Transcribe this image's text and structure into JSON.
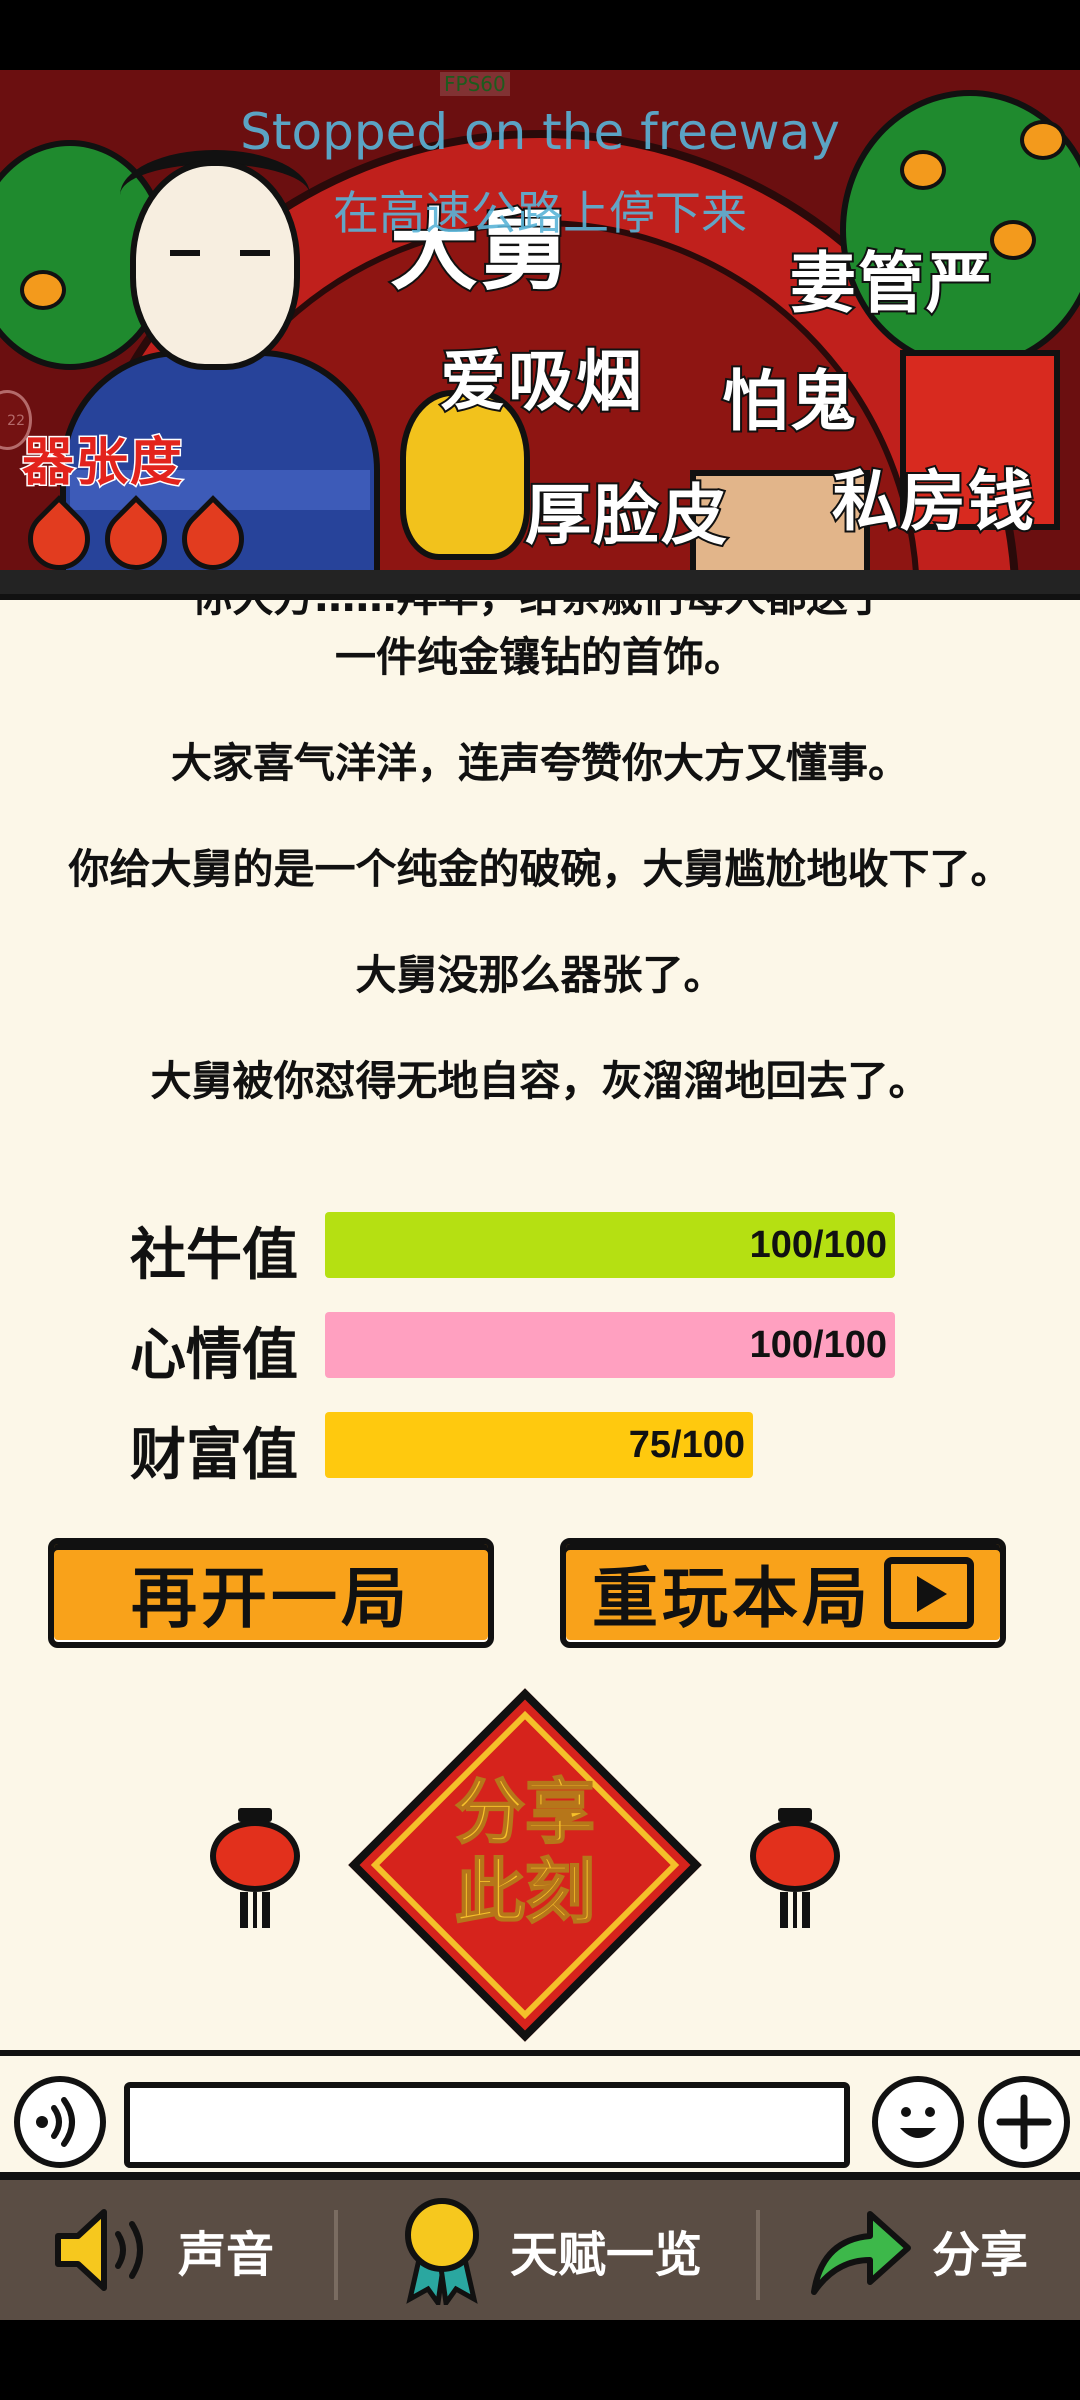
{
  "hud": {
    "fps": "FPS60",
    "caption_en": "Stopped on the freeway",
    "caption_zh": "在高速公路上停下来",
    "side_badge": "22"
  },
  "banner": {
    "title": "大舅",
    "tags": [
      "妻管严",
      "爱吸烟",
      "怕鬼",
      "厚脸皮",
      "私房钱"
    ],
    "attribute_label": "器张度",
    "flames": 3
  },
  "story": {
    "cut_line": "你大方……拜年，给亲戚们每人都送了",
    "lines": [
      "一件纯金镶钻的首饰。",
      "大家喜气洋洋，连声夸赞你大方又懂事。",
      "你给大舅的是一个纯金的破碗，大舅尴尬地收下了。",
      "大舅没那么器张了。",
      "大舅被你怼得无地自容，灰溜溜地回去了。"
    ]
  },
  "stats": [
    {
      "label": "社牛值",
      "value": 100,
      "max": 100,
      "display": "100/100",
      "color": "#b5e012"
    },
    {
      "label": "心情值",
      "value": 100,
      "max": 100,
      "display": "100/100",
      "color": "#ffa0c0"
    },
    {
      "label": "财富值",
      "value": 75,
      "max": 100,
      "display": "75/100",
      "color": "#ffc90e"
    }
  ],
  "buttons": {
    "new_game": "再开一局",
    "replay": "重玩本局"
  },
  "share_moment": {
    "line1": "分享",
    "line2": "此刻"
  },
  "chat": {
    "input_value": "",
    "icons": [
      "sound-wave-icon",
      "smiley-icon",
      "plus-icon"
    ]
  },
  "nav": {
    "sound": "声音",
    "talents": "天赋一览",
    "share": "分享"
  }
}
